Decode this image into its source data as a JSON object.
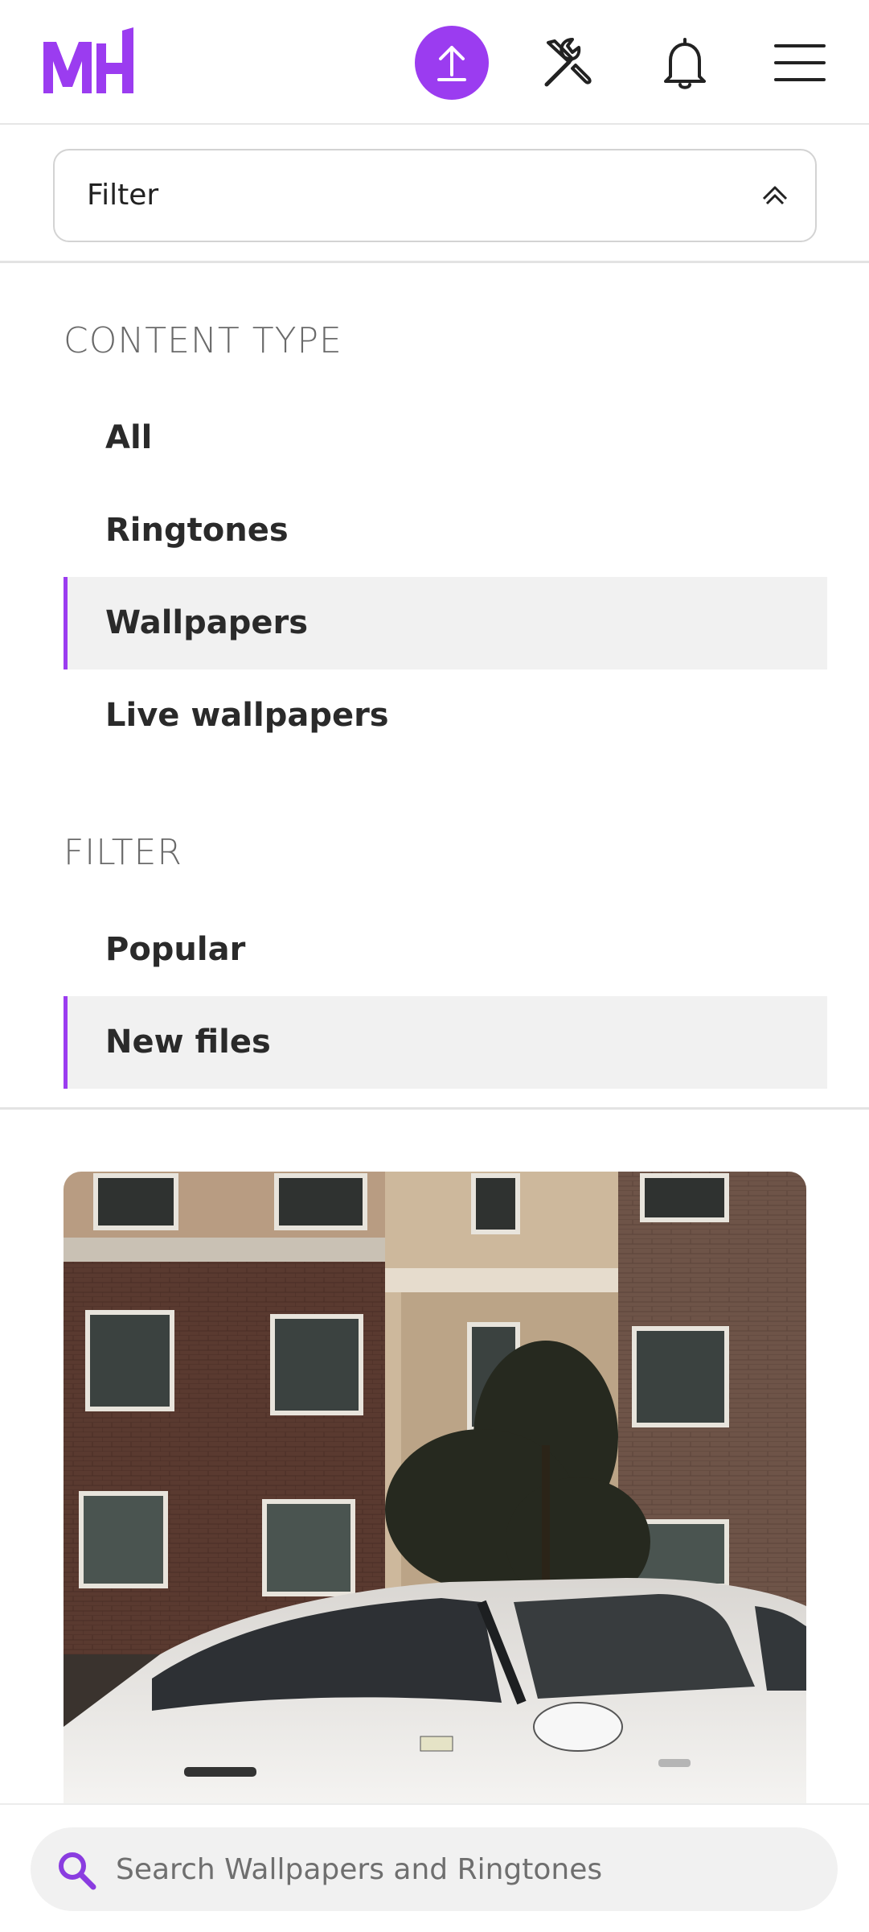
{
  "header": {
    "logo_text": "MH",
    "brand_color": "#9b3cf0",
    "icons": [
      "upload-icon",
      "tools-icon",
      "bell-icon",
      "hamburger-menu-icon"
    ]
  },
  "filter_toggle": {
    "label": "Filter",
    "state_icon": "chevron-up-icon"
  },
  "content_type": {
    "title": "CONTENT TYPE",
    "options": [
      "All",
      "Ringtones",
      "Wallpapers",
      "Live wallpapers"
    ],
    "selected": "Wallpapers"
  },
  "filter": {
    "title": "FILTER",
    "options": [
      "Popular",
      "New files"
    ],
    "selected": "New files"
  },
  "search": {
    "placeholder": "Search Wallpapers and Ringtones"
  }
}
